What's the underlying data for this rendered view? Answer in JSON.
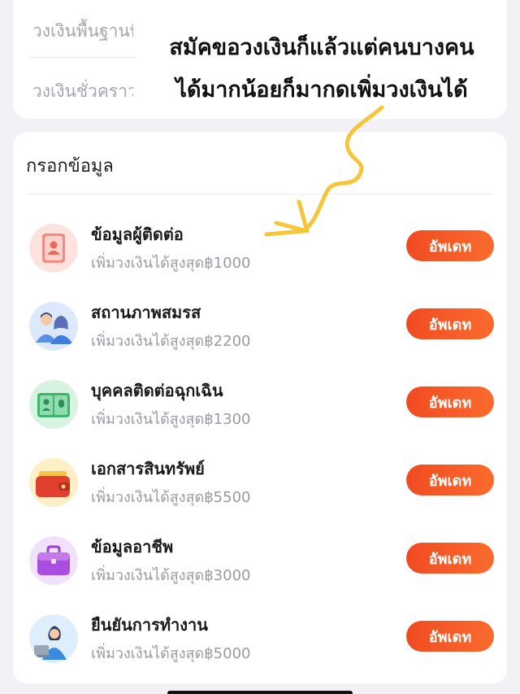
{
  "limits": {
    "base_label": "วงเงินพื้นฐานที่ได้รับ",
    "temp_label": "วงเงินชั่วคราว"
  },
  "overlay": {
    "line1": "สมัคขอวงเงินก็แล้วแต่คนบางคน",
    "line2": "ได้มากน้อยก็มากดเพิ่มวงเงินได้"
  },
  "section": {
    "title": "กรอกข้อมูล"
  },
  "items": [
    {
      "title": "ข้อมูลผู้ติดต่อ",
      "subtitle": "เพิ่มวงเงินได้สูงสุด฿1000",
      "button": "อัพเดท",
      "icon": "contact-book-icon"
    },
    {
      "title": "สถานภาพสมรส",
      "subtitle": "เพิ่มวงเงินได้สูงสุด฿2200",
      "button": "อัพเดท",
      "icon": "couple-icon"
    },
    {
      "title": "บุคคลติดต่อฉุกเฉิน",
      "subtitle": "เพิ่มวงเงินได้สูงสุด฿1300",
      "button": "อัพเดท",
      "icon": "emergency-contact-icon"
    },
    {
      "title": "เอกสารสินทรัพย์",
      "subtitle": "เพิ่มวงเงินได้สูงสุด฿5500",
      "button": "อัพเดท",
      "icon": "wallet-icon"
    },
    {
      "title": "ข้อมูลอาชีพ",
      "subtitle": "เพิ่มวงเงินได้สูงสุด฿3000",
      "button": "อัพเดท",
      "icon": "briefcase-icon"
    },
    {
      "title": "ยืนยันการทำงาน",
      "subtitle": "เพิ่มวงเงินได้สูงสุด฿5000",
      "button": "อัพเดท",
      "icon": "office-worker-icon"
    }
  ],
  "colors": {
    "accent": "#f04b22",
    "arrow": "#f5c53a"
  }
}
